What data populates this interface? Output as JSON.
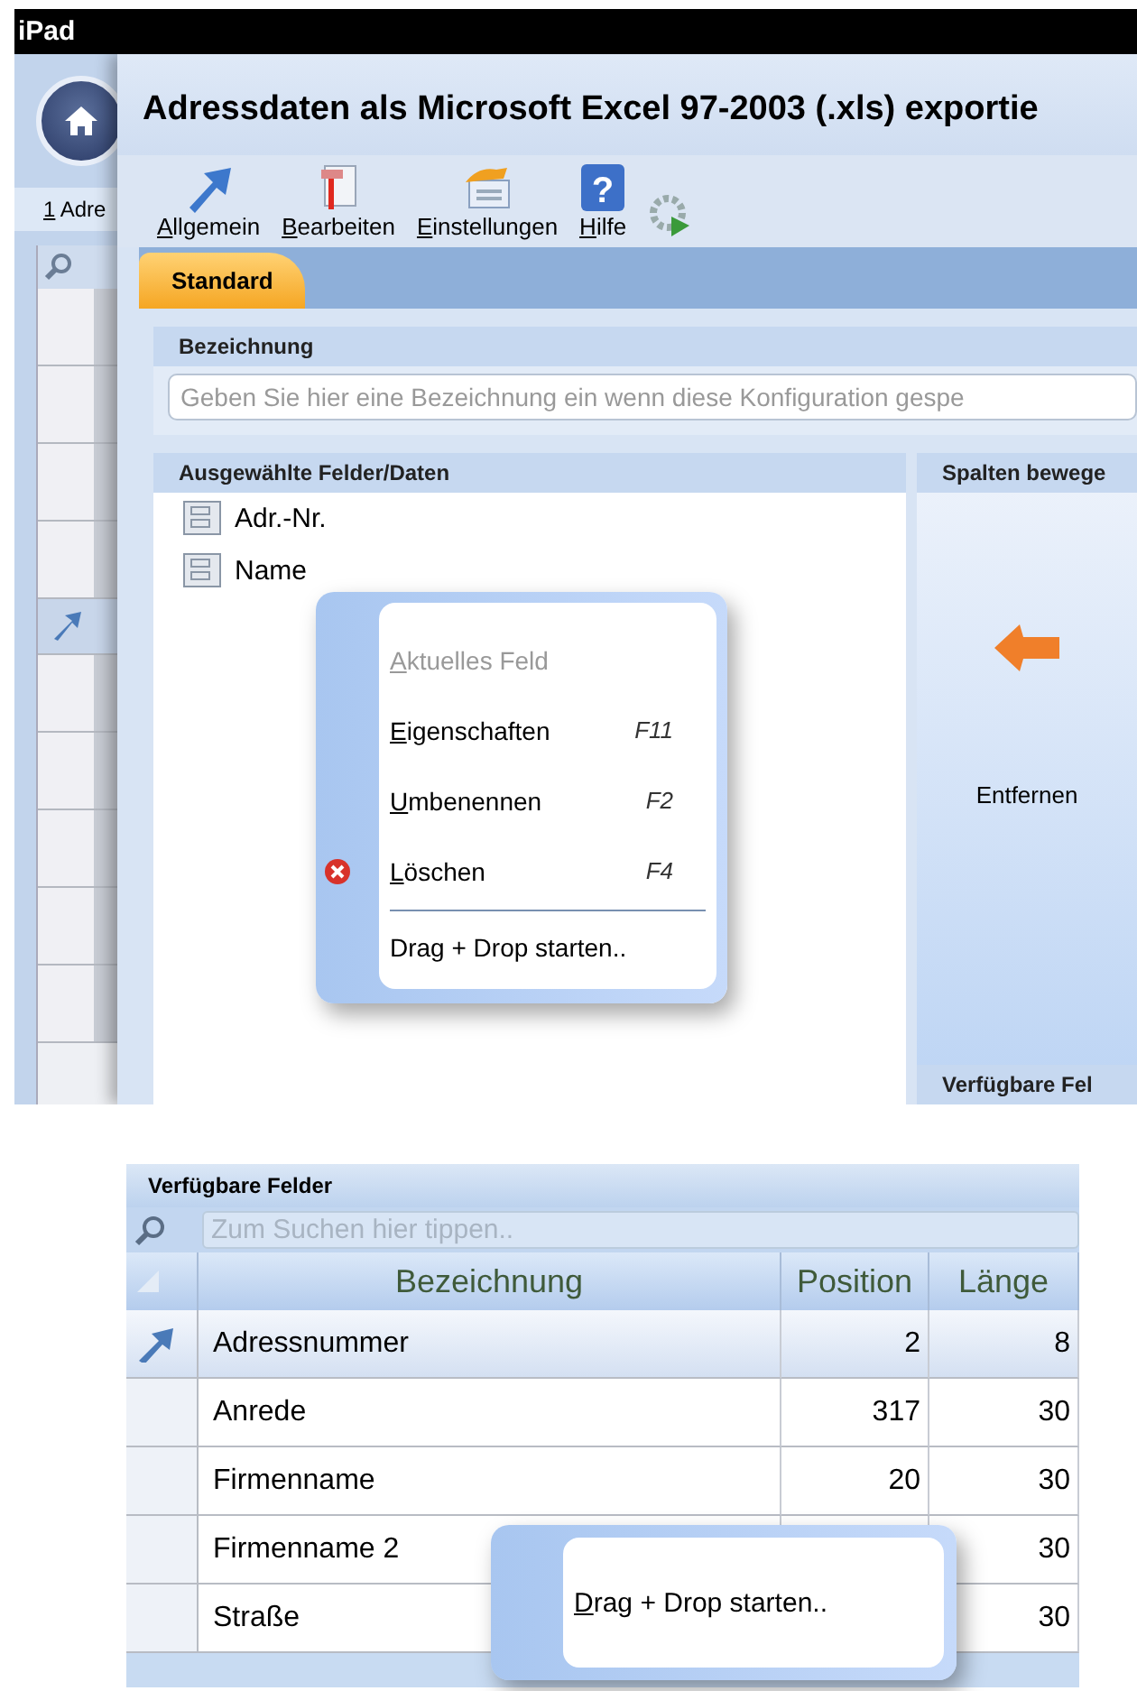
{
  "device_bar": {
    "title": "iPad"
  },
  "background_window": {
    "tab": "1 Adre"
  },
  "dialog": {
    "title": "Adressdaten als Microsoft Excel 97-2003 (.xls) exportie",
    "toolbar": [
      {
        "kind": "arrow",
        "label": "Allgemein"
      },
      {
        "kind": "edit",
        "label": "Bearbeiten"
      },
      {
        "kind": "settings",
        "label": "Einstellungen"
      },
      {
        "kind": "help",
        "label": "Hilfe",
        "glyph": "?"
      },
      {
        "kind": "run"
      }
    ],
    "tabs": [
      {
        "label": "Standard",
        "selected": true
      }
    ],
    "name_section": {
      "title": "Bezeichnung",
      "placeholder": "Geben Sie hier eine Bezeichnung ein wenn diese Konfiguration gespe"
    },
    "selected_fields": {
      "title": "Ausgewählte Felder/Daten",
      "items": [
        "Adr.-Nr.",
        "Name"
      ]
    },
    "move_panel": {
      "title": "Spalten bewege",
      "action": "Entfernen",
      "footer": "Verfügbare Fel"
    },
    "context_menu": [
      {
        "kind": "item",
        "label": "Aktuelles Feld",
        "disabled": true
      },
      {
        "kind": "item",
        "label": "Eigenschaften",
        "shortcut": "F11",
        "disabled": false
      },
      {
        "kind": "item",
        "label": "Umbenennen",
        "shortcut": "F2",
        "disabled": false
      },
      {
        "kind": "delete_item",
        "label": "Löschen",
        "shortcut": "F4",
        "disabled": false
      },
      {
        "kind": "separator"
      },
      {
        "kind": "plain",
        "label": "Drag + Drop starten..",
        "disabled": false
      }
    ]
  },
  "available_fields": {
    "title": "Verfügbare Felder",
    "search_placeholder": "Zum Suchen hier tippen..",
    "columns": [
      "Bezeichnung",
      "Position",
      "Länge"
    ],
    "rows": [
      {
        "cells": [
          "Adressnummer",
          "2",
          "8"
        ],
        "selected": true
      },
      {
        "cells": [
          "Anrede",
          "317",
          "30"
        ],
        "selected": false
      },
      {
        "cells": [
          "Firmenname",
          "20",
          "30"
        ],
        "selected": false
      },
      {
        "cells": [
          "Firmenname 2",
          "",
          "30"
        ],
        "selected": false
      },
      {
        "cells": [
          "Straße",
          "",
          "30"
        ],
        "selected": false
      }
    ],
    "drag_menu": {
      "label": "Drag + Drop starten.."
    }
  }
}
